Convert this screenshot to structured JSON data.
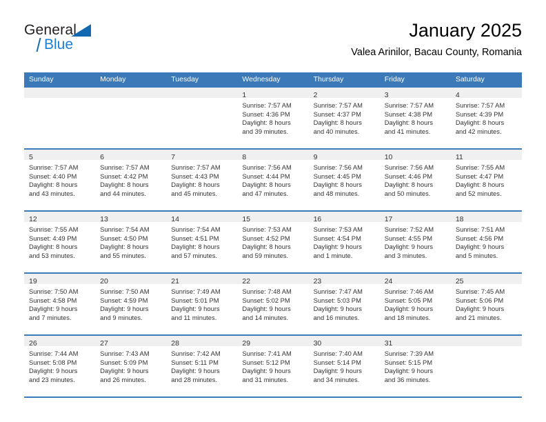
{
  "logo": {
    "general": "General",
    "blue": "Blue"
  },
  "header": {
    "title": "January 2025",
    "subtitle": "Valea Arinilor, Bacau County, Romania"
  },
  "colors": {
    "header_blue": "#3b79b8",
    "daynum_strip": "#f0f0f0",
    "logo_blue": "#1b7fd4",
    "text": "#333333"
  },
  "weekdays": [
    "Sunday",
    "Monday",
    "Tuesday",
    "Wednesday",
    "Thursday",
    "Friday",
    "Saturday"
  ],
  "weeks": [
    [
      {
        "day": "",
        "sunrise": "",
        "sunset": "",
        "daylight1": "",
        "daylight2": "",
        "empty": true
      },
      {
        "day": "",
        "sunrise": "",
        "sunset": "",
        "daylight1": "",
        "daylight2": "",
        "empty": true
      },
      {
        "day": "",
        "sunrise": "",
        "sunset": "",
        "daylight1": "",
        "daylight2": "",
        "empty": true
      },
      {
        "day": "1",
        "sunrise": "Sunrise: 7:57 AM",
        "sunset": "Sunset: 4:36 PM",
        "daylight1": "Daylight: 8 hours",
        "daylight2": "and 39 minutes."
      },
      {
        "day": "2",
        "sunrise": "Sunrise: 7:57 AM",
        "sunset": "Sunset: 4:37 PM",
        "daylight1": "Daylight: 8 hours",
        "daylight2": "and 40 minutes."
      },
      {
        "day": "3",
        "sunrise": "Sunrise: 7:57 AM",
        "sunset": "Sunset: 4:38 PM",
        "daylight1": "Daylight: 8 hours",
        "daylight2": "and 41 minutes."
      },
      {
        "day": "4",
        "sunrise": "Sunrise: 7:57 AM",
        "sunset": "Sunset: 4:39 PM",
        "daylight1": "Daylight: 8 hours",
        "daylight2": "and 42 minutes."
      }
    ],
    [
      {
        "day": "5",
        "sunrise": "Sunrise: 7:57 AM",
        "sunset": "Sunset: 4:40 PM",
        "daylight1": "Daylight: 8 hours",
        "daylight2": "and 43 minutes."
      },
      {
        "day": "6",
        "sunrise": "Sunrise: 7:57 AM",
        "sunset": "Sunset: 4:42 PM",
        "daylight1": "Daylight: 8 hours",
        "daylight2": "and 44 minutes."
      },
      {
        "day": "7",
        "sunrise": "Sunrise: 7:57 AM",
        "sunset": "Sunset: 4:43 PM",
        "daylight1": "Daylight: 8 hours",
        "daylight2": "and 45 minutes."
      },
      {
        "day": "8",
        "sunrise": "Sunrise: 7:56 AM",
        "sunset": "Sunset: 4:44 PM",
        "daylight1": "Daylight: 8 hours",
        "daylight2": "and 47 minutes."
      },
      {
        "day": "9",
        "sunrise": "Sunrise: 7:56 AM",
        "sunset": "Sunset: 4:45 PM",
        "daylight1": "Daylight: 8 hours",
        "daylight2": "and 48 minutes."
      },
      {
        "day": "10",
        "sunrise": "Sunrise: 7:56 AM",
        "sunset": "Sunset: 4:46 PM",
        "daylight1": "Daylight: 8 hours",
        "daylight2": "and 50 minutes."
      },
      {
        "day": "11",
        "sunrise": "Sunrise: 7:55 AM",
        "sunset": "Sunset: 4:47 PM",
        "daylight1": "Daylight: 8 hours",
        "daylight2": "and 52 minutes."
      }
    ],
    [
      {
        "day": "12",
        "sunrise": "Sunrise: 7:55 AM",
        "sunset": "Sunset: 4:49 PM",
        "daylight1": "Daylight: 8 hours",
        "daylight2": "and 53 minutes."
      },
      {
        "day": "13",
        "sunrise": "Sunrise: 7:54 AM",
        "sunset": "Sunset: 4:50 PM",
        "daylight1": "Daylight: 8 hours",
        "daylight2": "and 55 minutes."
      },
      {
        "day": "14",
        "sunrise": "Sunrise: 7:54 AM",
        "sunset": "Sunset: 4:51 PM",
        "daylight1": "Daylight: 8 hours",
        "daylight2": "and 57 minutes."
      },
      {
        "day": "15",
        "sunrise": "Sunrise: 7:53 AM",
        "sunset": "Sunset: 4:52 PM",
        "daylight1": "Daylight: 8 hours",
        "daylight2": "and 59 minutes."
      },
      {
        "day": "16",
        "sunrise": "Sunrise: 7:53 AM",
        "sunset": "Sunset: 4:54 PM",
        "daylight1": "Daylight: 9 hours",
        "daylight2": "and 1 minute."
      },
      {
        "day": "17",
        "sunrise": "Sunrise: 7:52 AM",
        "sunset": "Sunset: 4:55 PM",
        "daylight1": "Daylight: 9 hours",
        "daylight2": "and 3 minutes."
      },
      {
        "day": "18",
        "sunrise": "Sunrise: 7:51 AM",
        "sunset": "Sunset: 4:56 PM",
        "daylight1": "Daylight: 9 hours",
        "daylight2": "and 5 minutes."
      }
    ],
    [
      {
        "day": "19",
        "sunrise": "Sunrise: 7:50 AM",
        "sunset": "Sunset: 4:58 PM",
        "daylight1": "Daylight: 9 hours",
        "daylight2": "and 7 minutes."
      },
      {
        "day": "20",
        "sunrise": "Sunrise: 7:50 AM",
        "sunset": "Sunset: 4:59 PM",
        "daylight1": "Daylight: 9 hours",
        "daylight2": "and 9 minutes."
      },
      {
        "day": "21",
        "sunrise": "Sunrise: 7:49 AM",
        "sunset": "Sunset: 5:01 PM",
        "daylight1": "Daylight: 9 hours",
        "daylight2": "and 11 minutes."
      },
      {
        "day": "22",
        "sunrise": "Sunrise: 7:48 AM",
        "sunset": "Sunset: 5:02 PM",
        "daylight1": "Daylight: 9 hours",
        "daylight2": "and 14 minutes."
      },
      {
        "day": "23",
        "sunrise": "Sunrise: 7:47 AM",
        "sunset": "Sunset: 5:03 PM",
        "daylight1": "Daylight: 9 hours",
        "daylight2": "and 16 minutes."
      },
      {
        "day": "24",
        "sunrise": "Sunrise: 7:46 AM",
        "sunset": "Sunset: 5:05 PM",
        "daylight1": "Daylight: 9 hours",
        "daylight2": "and 18 minutes."
      },
      {
        "day": "25",
        "sunrise": "Sunrise: 7:45 AM",
        "sunset": "Sunset: 5:06 PM",
        "daylight1": "Daylight: 9 hours",
        "daylight2": "and 21 minutes."
      }
    ],
    [
      {
        "day": "26",
        "sunrise": "Sunrise: 7:44 AM",
        "sunset": "Sunset: 5:08 PM",
        "daylight1": "Daylight: 9 hours",
        "daylight2": "and 23 minutes."
      },
      {
        "day": "27",
        "sunrise": "Sunrise: 7:43 AM",
        "sunset": "Sunset: 5:09 PM",
        "daylight1": "Daylight: 9 hours",
        "daylight2": "and 26 minutes."
      },
      {
        "day": "28",
        "sunrise": "Sunrise: 7:42 AM",
        "sunset": "Sunset: 5:11 PM",
        "daylight1": "Daylight: 9 hours",
        "daylight2": "and 28 minutes."
      },
      {
        "day": "29",
        "sunrise": "Sunrise: 7:41 AM",
        "sunset": "Sunset: 5:12 PM",
        "daylight1": "Daylight: 9 hours",
        "daylight2": "and 31 minutes."
      },
      {
        "day": "30",
        "sunrise": "Sunrise: 7:40 AM",
        "sunset": "Sunset: 5:14 PM",
        "daylight1": "Daylight: 9 hours",
        "daylight2": "and 34 minutes."
      },
      {
        "day": "31",
        "sunrise": "Sunrise: 7:39 AM",
        "sunset": "Sunset: 5:15 PM",
        "daylight1": "Daylight: 9 hours",
        "daylight2": "and 36 minutes."
      },
      {
        "day": "",
        "sunrise": "",
        "sunset": "",
        "daylight1": "",
        "daylight2": "",
        "empty": true
      }
    ]
  ]
}
